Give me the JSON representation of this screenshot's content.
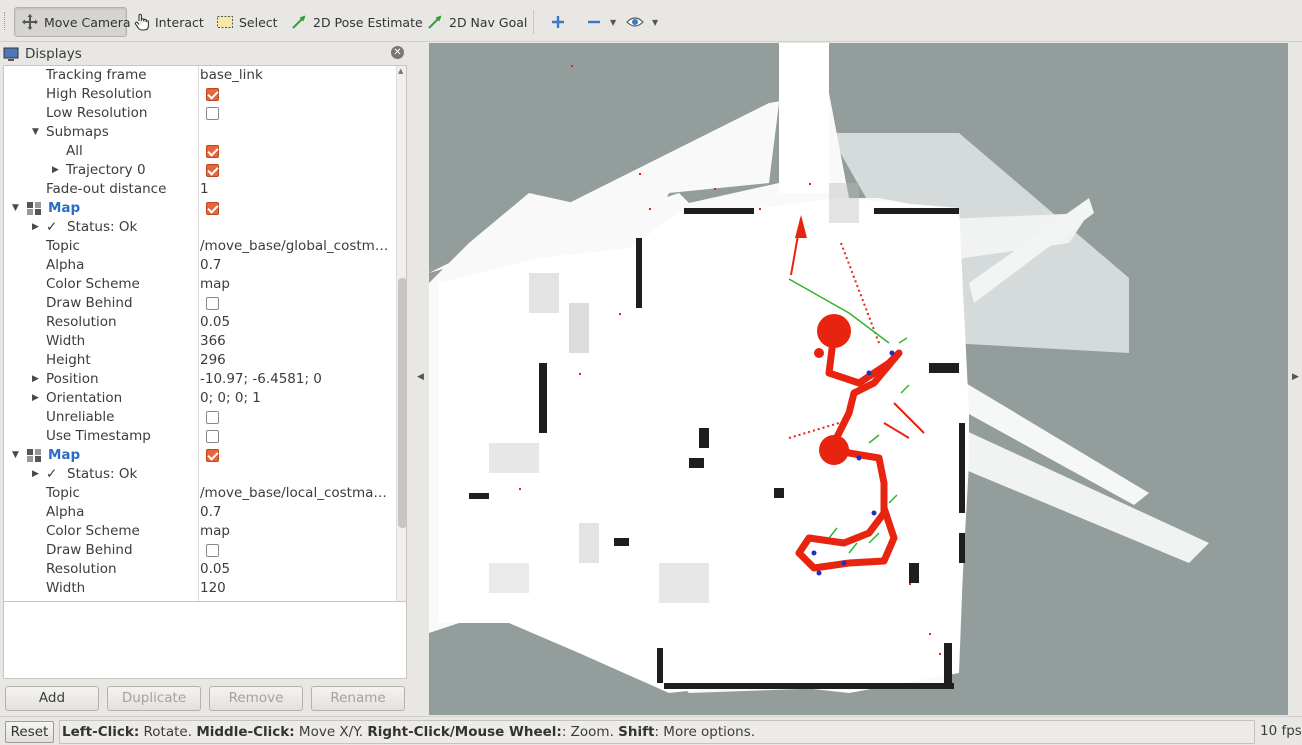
{
  "toolbar": {
    "move_camera": "Move Camera",
    "interact": "Interact",
    "select": "Select",
    "pose_estimate": "2D Pose Estimate",
    "nav_goal": "2D Nav Goal"
  },
  "displays_panel": {
    "title": "Displays",
    "rows": [
      {
        "label": "Tracking frame",
        "value": "base_link"
      },
      {
        "label": "High Resolution",
        "checked": true
      },
      {
        "label": "Low Resolution",
        "checked": false
      },
      {
        "label": "Submaps"
      },
      {
        "label": "All",
        "checked": true
      },
      {
        "label": "Trajectory 0",
        "checked": true
      },
      {
        "label": "Fade-out distance",
        "value": "1"
      },
      {
        "label": "Map",
        "checked": true
      },
      {
        "label": "Status: Ok"
      },
      {
        "label": "Topic",
        "value": "/move_base/global_costmap/costmap"
      },
      {
        "label": "Alpha",
        "value": "0.7"
      },
      {
        "label": "Color Scheme",
        "value": "map"
      },
      {
        "label": "Draw Behind",
        "checked": false
      },
      {
        "label": "Resolution",
        "value": "0.05"
      },
      {
        "label": "Width",
        "value": "366"
      },
      {
        "label": "Height",
        "value": "296"
      },
      {
        "label": "Position",
        "value": "-10.97; -6.4581; 0"
      },
      {
        "label": "Orientation",
        "value": "0; 0; 0; 1"
      },
      {
        "label": "Unreliable",
        "checked": false
      },
      {
        "label": "Use Timestamp",
        "checked": false
      },
      {
        "label": "Map",
        "checked": true
      },
      {
        "label": "Status: Ok"
      },
      {
        "label": "Topic",
        "value": "/move_base/local_costmap/costmap"
      },
      {
        "label": "Alpha",
        "value": "0.7"
      },
      {
        "label": "Color Scheme",
        "value": "map"
      },
      {
        "label": "Draw Behind",
        "checked": false
      },
      {
        "label": "Resolution",
        "value": "0.05"
      },
      {
        "label": "Width",
        "value": "120"
      }
    ],
    "buttons": {
      "add": "Add",
      "duplicate": "Duplicate",
      "remove": "Remove",
      "rename": "Rename"
    }
  },
  "status_bar": {
    "reset": "Reset",
    "hint_parts": [
      {
        "b": "Left-Click:",
        "t": " Rotate. "
      },
      {
        "b": "Middle-Click:",
        "t": " Move X/Y. "
      },
      {
        "b": "Right-Click/Mouse Wheel:",
        "t": ": Zoom. "
      },
      {
        "b": "Shift",
        "t": ": More options."
      }
    ],
    "fps": "10 fps"
  },
  "colors": {
    "checkbox_on": "#e9663a",
    "link_blue": "#2b6cc4",
    "viewport_bg": "#939e9c",
    "path_red": "#e8230f"
  }
}
